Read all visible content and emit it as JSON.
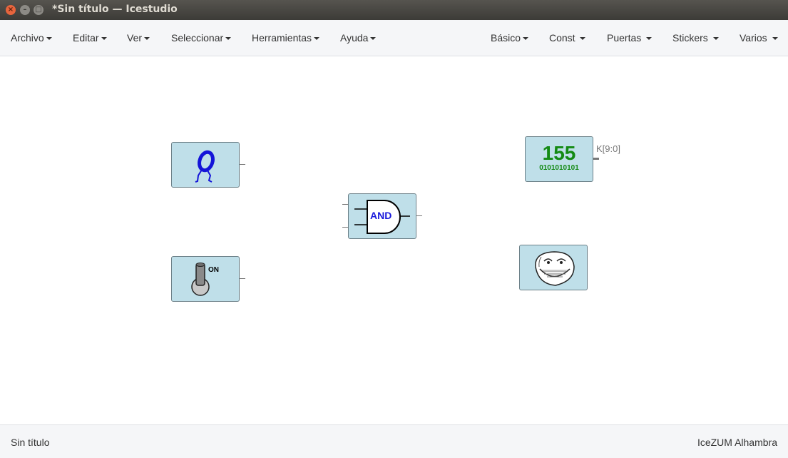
{
  "window": {
    "title": "*Sin título — Icestudio",
    "buttons": {
      "close": "×",
      "minimize": "–",
      "maximize": "□"
    }
  },
  "menubar": {
    "left": [
      {
        "label": "Archivo"
      },
      {
        "label": "Editar"
      },
      {
        "label": "Ver"
      },
      {
        "label": "Seleccionar"
      },
      {
        "label": "Herramientas"
      },
      {
        "label": "Ayuda"
      }
    ],
    "right": [
      {
        "label": "Básico"
      },
      {
        "label": "Const "
      },
      {
        "label": "Puertas "
      },
      {
        "label": "Stickers "
      },
      {
        "label": "Varios "
      }
    ]
  },
  "canvas": {
    "blocks": {
      "and_gate": {
        "text": "AND"
      },
      "constant": {
        "value": "155",
        "bits": "0101010101",
        "port_label": "K[9:0]"
      },
      "switch": {
        "text": "ON"
      }
    }
  },
  "statusbar": {
    "left": "Sin título",
    "right": "IceZUM Alhambra"
  },
  "colors": {
    "block_fill": "#bfdfe9",
    "block_border": "#6c8088",
    "and_label": "#1a1adb",
    "constant_green": "#138a13",
    "titlebar": "#3c3b37"
  }
}
